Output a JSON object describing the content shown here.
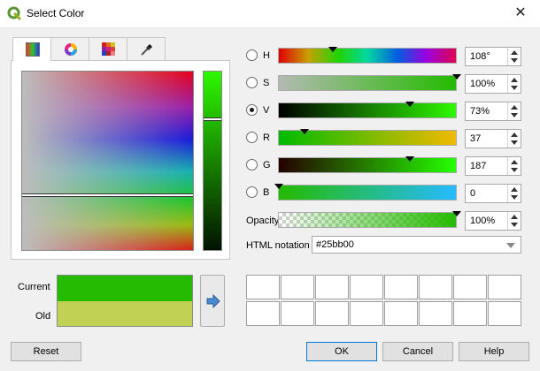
{
  "window": {
    "title": "Select Color",
    "close_icon": "close-icon"
  },
  "tabs": [
    {
      "name": "color-ramp-tab",
      "icon": "color-ramp-icon",
      "active": true
    },
    {
      "name": "color-wheel-tab",
      "icon": "color-wheel-icon",
      "active": false
    },
    {
      "name": "swatches-tab",
      "icon": "swatches-grid-icon",
      "active": false
    },
    {
      "name": "sampler-tab",
      "icon": "eyedropper-icon",
      "active": false
    }
  ],
  "components": [
    {
      "key": "H",
      "label": "H",
      "value": "108°",
      "checked": false
    },
    {
      "key": "S",
      "label": "S",
      "value": "100%",
      "checked": false
    },
    {
      "key": "V",
      "label": "V",
      "value": "73%",
      "checked": true
    },
    {
      "key": "R",
      "label": "R",
      "value": "37",
      "checked": false
    },
    {
      "key": "G",
      "label": "G",
      "value": "187",
      "checked": false
    },
    {
      "key": "B",
      "label": "B",
      "value": "0",
      "checked": false
    }
  ],
  "opacity": {
    "label": "Opacity",
    "value": "100%"
  },
  "html_notation": {
    "label": "HTML notation",
    "value": "#25bb00"
  },
  "preview": {
    "current_label": "Current",
    "old_label": "Old",
    "current_color": "#25bb00",
    "old_color": "#c0d154"
  },
  "buttons": {
    "reset": "Reset",
    "ok": "OK",
    "cancel": "Cancel",
    "help": "Help"
  },
  "colors": {
    "selected": "#25bb00",
    "default_button_border": "#0078d7"
  }
}
